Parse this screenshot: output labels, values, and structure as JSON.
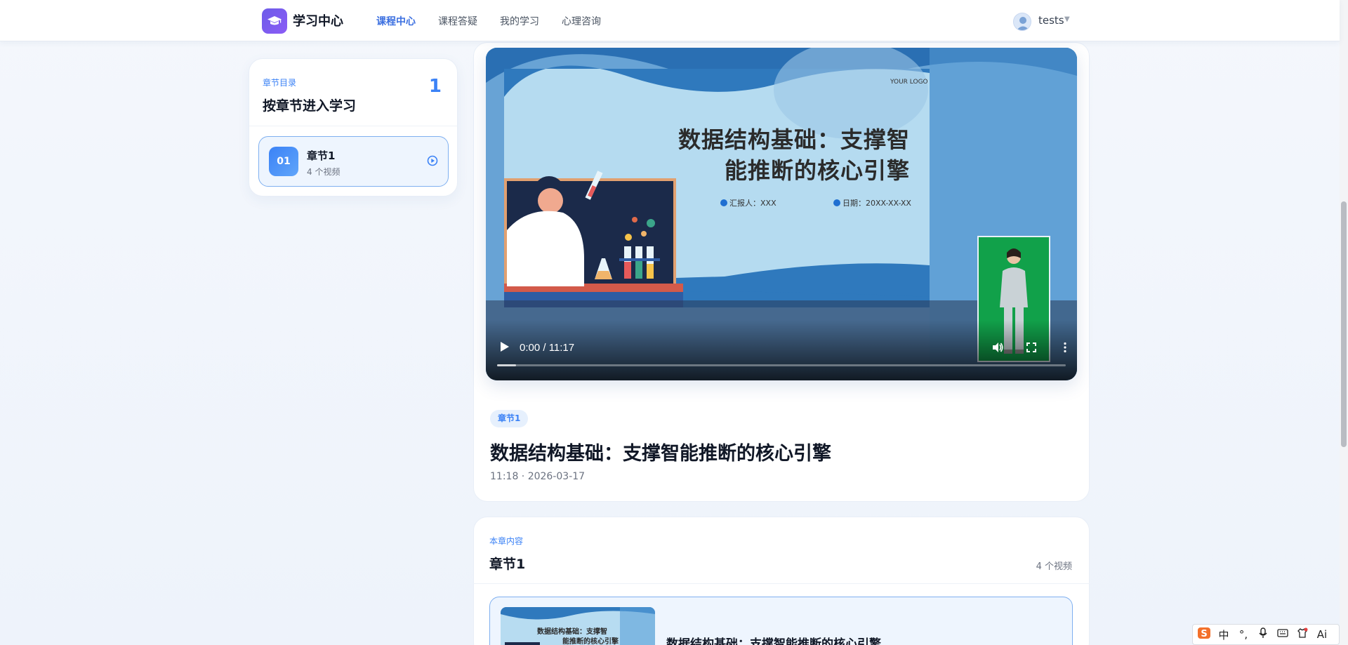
{
  "header": {
    "app_title": "学习中心",
    "nav": [
      {
        "label": "课程中心",
        "active": true
      },
      {
        "label": "课程答疑",
        "active": false
      },
      {
        "label": "我的学习",
        "active": false
      },
      {
        "label": "心理咨询",
        "active": false
      }
    ],
    "user": {
      "name": "tests"
    }
  },
  "sidebar": {
    "kicker": "章节目录",
    "title": "按章节进入学习",
    "count": "1",
    "chapters": [
      {
        "number": "01",
        "name": "章节1",
        "subtitle": "4 个视频"
      }
    ]
  },
  "video": {
    "slide": {
      "logo": "YOUR LOGO",
      "title_line1": "数据结构基础：支撑智",
      "title_line2": "能推断的核心引擎",
      "reporter": "汇报人：XXX",
      "date": "日期：20XX-XX-XX"
    },
    "controls": {
      "time": "0:00 / 11:17",
      "progress": 0
    },
    "tag": "章节1",
    "title": "数据结构基础：支撑智能推断的核心引擎",
    "meta": "11:18 · 2026-03-17"
  },
  "content": {
    "kicker": "本章内容",
    "title": "章节1",
    "count": "4 个视频",
    "items": [
      {
        "title": "数据结构基础：支撑智能推断的核心引擎",
        "thumb_line1": "数据结构基础：支撑智",
        "thumb_line2": "能推断的核心引擎"
      }
    ]
  },
  "ime": {
    "items": [
      "S",
      "中",
      "°,",
      "mic-icon",
      "keyboard-icon",
      "shirt-icon",
      "Ai"
    ]
  },
  "colors": {
    "accent": "#3b82f6",
    "brand": "#6d5ce8",
    "card_border": "#7fb0f0"
  }
}
